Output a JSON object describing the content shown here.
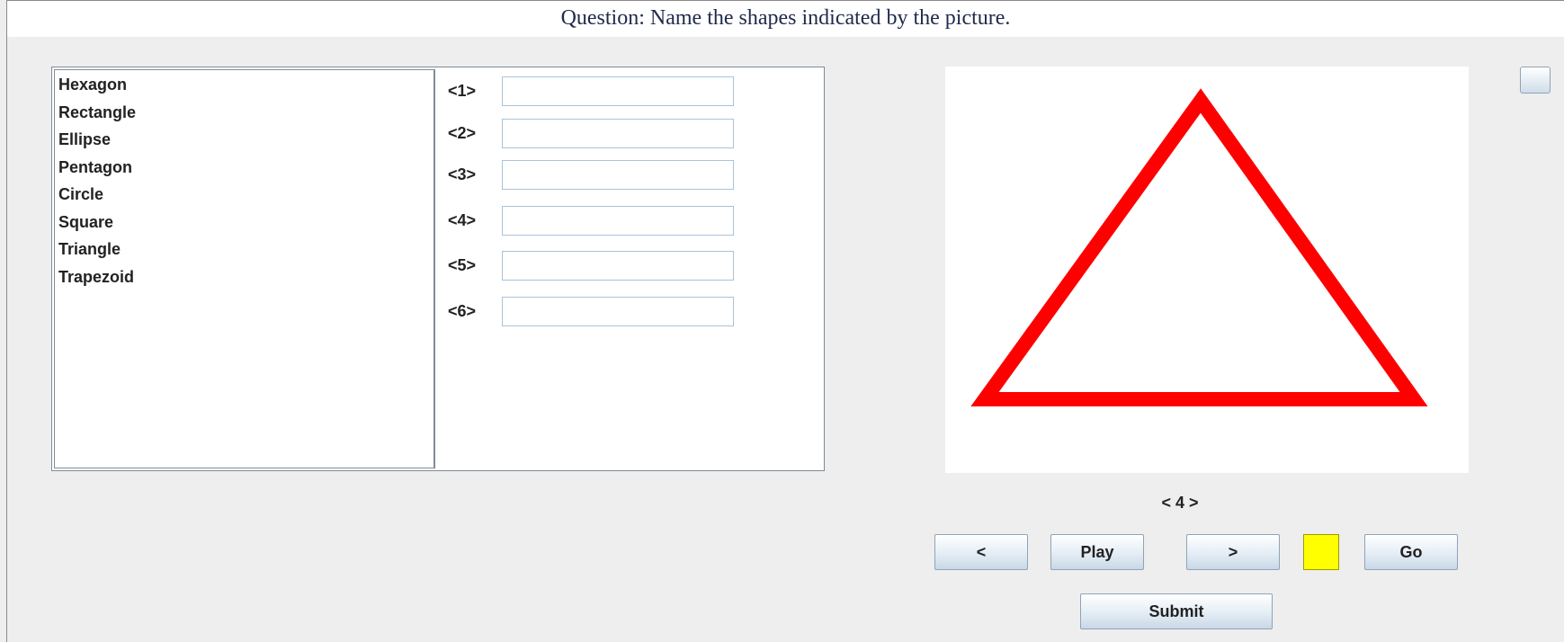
{
  "question": {
    "title": "Question: Name the shapes indicated by the picture."
  },
  "word_bank": {
    "items": [
      "Hexagon",
      "Rectangle",
      "Ellipse",
      "Pentagon",
      "Circle",
      "Square",
      "Triangle",
      "Trapezoid"
    ]
  },
  "answers": {
    "labels": [
      "<1>",
      "<2>",
      "<3>",
      "<4>",
      "<5>",
      "<6>"
    ],
    "values": [
      "",
      "",
      "",
      "",
      "",
      ""
    ]
  },
  "picture": {
    "shape": "triangle",
    "stroke_color": "#ff0000",
    "fill_color": "#ffffff"
  },
  "navigation": {
    "page_indicator": "< 4 >",
    "prev_label": "<",
    "play_label": "Play",
    "next_label": ">",
    "go_label": "Go",
    "status_color": "#ffff00"
  },
  "submit_label": "Submit"
}
